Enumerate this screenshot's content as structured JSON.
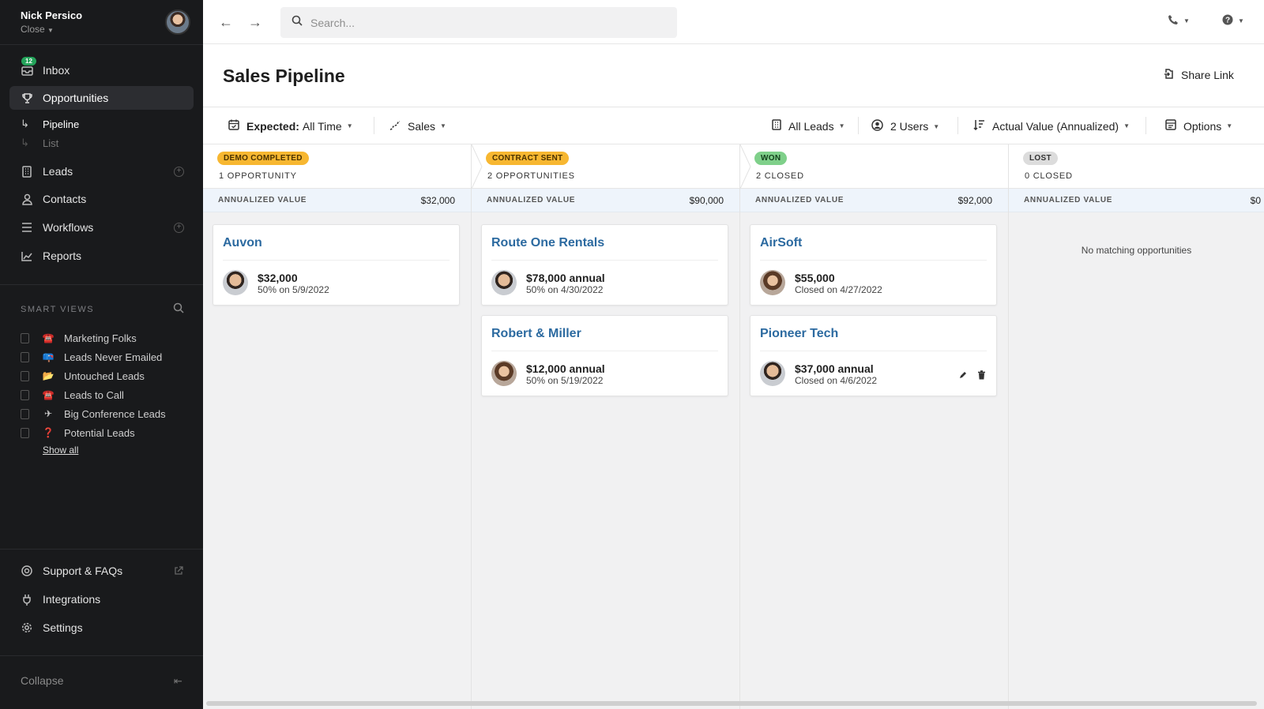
{
  "user": {
    "name": "Nick Persico",
    "org": "Close"
  },
  "inbox": {
    "label": "Inbox",
    "badge": "12"
  },
  "nav": {
    "opportunities": "Opportunities",
    "pipeline": "Pipeline",
    "list": "List",
    "leads": "Leads",
    "contacts": "Contacts",
    "workflows": "Workflows",
    "reports": "Reports"
  },
  "smart_views": {
    "title": "SMART VIEWS",
    "items": [
      {
        "emoji": "☎️",
        "label": "Marketing Folks"
      },
      {
        "emoji": "📪",
        "label": "Leads Never Emailed"
      },
      {
        "emoji": "📂",
        "label": "Untouched Leads"
      },
      {
        "emoji": "☎️",
        "label": "Leads to Call"
      },
      {
        "emoji": "✈",
        "label": "Big Conference Leads"
      },
      {
        "emoji": "❓",
        "label": "Potential Leads"
      }
    ],
    "show_all": "Show all"
  },
  "bottom_nav": {
    "support": "Support & FAQs",
    "integrations": "Integrations",
    "settings": "Settings",
    "collapse": "Collapse"
  },
  "search": {
    "placeholder": "Search..."
  },
  "page": {
    "title": "Sales Pipeline",
    "share": "Share Link"
  },
  "filters": {
    "expected_label": "Expected:",
    "expected_value": "All Time",
    "pipeline": "Sales",
    "leads": "All Leads",
    "users": "2 Users",
    "sort": "Actual Value (Annualized)",
    "options": "Options"
  },
  "annualized_label": "ANNUALIZED VALUE",
  "columns": [
    {
      "stage": "DEMO COMPLETED",
      "stage_bg": "#f7b731",
      "count": "1 OPPORTUNITY",
      "total": "$32,000",
      "cards": [
        {
          "title": "Auvon",
          "value": "$32,000",
          "sub": "50% on 5/9/2022",
          "avatar": "m"
        }
      ]
    },
    {
      "stage": "CONTRACT SENT",
      "stage_bg": "#f7b731",
      "count": "2 OPPORTUNITIES",
      "total": "$90,000",
      "cards": [
        {
          "title": "Route One Rentals",
          "value": "$78,000 annual",
          "sub": "50% on 4/30/2022",
          "avatar": "m"
        },
        {
          "title": "Robert & Miller",
          "value": "$12,000 annual",
          "sub": "50% on 5/19/2022",
          "avatar": "f"
        }
      ]
    },
    {
      "stage": "WON",
      "stage_bg": "#7fd08a",
      "count": "2 CLOSED",
      "total": "$92,000",
      "cards": [
        {
          "title": "AirSoft",
          "value": "$55,000",
          "sub": "Closed on 4/27/2022",
          "avatar": "f"
        },
        {
          "title": "Pioneer Tech",
          "value": "$37,000 annual",
          "sub": "Closed on 4/6/2022",
          "avatar": "m"
        }
      ]
    },
    {
      "stage": "LOST",
      "stage_bg": "#dcdcdc",
      "count": "0 CLOSED",
      "total": "$0",
      "empty": "No matching opportunities",
      "cards": []
    }
  ]
}
